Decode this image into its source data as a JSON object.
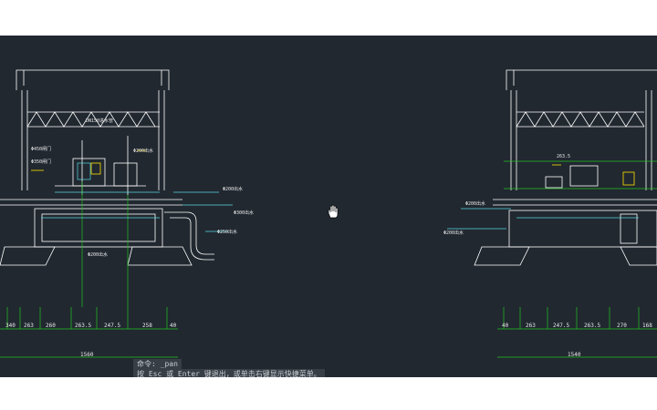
{
  "command_line": {
    "line1": "命令: _pan",
    "line2": "按 Esc 或 Enter 键退出，或单击右键显示快捷菜单。"
  },
  "left_drawing": {
    "labels": [
      {
        "id": "l1",
        "text": "DN150进水管"
      },
      {
        "id": "l2",
        "text": "Φ450闸门"
      },
      {
        "id": "l3",
        "text": "Φ350闸门"
      },
      {
        "id": "l4",
        "text": "Φ200出水"
      },
      {
        "id": "l5",
        "text": "Φ200出水"
      },
      {
        "id": "l6",
        "text": "Φ300出水"
      },
      {
        "id": "l7",
        "text": "Φ250出水"
      },
      {
        "id": "l8",
        "text": "Φ200出水"
      }
    ],
    "dimensions": [
      "340",
      "263",
      "260",
      "263.5",
      "247.5",
      "258",
      "40"
    ],
    "total": "1560"
  },
  "right_drawing": {
    "labels": [
      {
        "id": "r1",
        "text": "263.5"
      },
      {
        "id": "r2",
        "text": "Φ200出水"
      },
      {
        "id": "r3",
        "text": "Φ200出水"
      }
    ],
    "dimensions": [
      "40",
      "263",
      "247.5",
      "263.5",
      "270",
      "168"
    ],
    "total": "1540"
  },
  "colors": {
    "background": "#212830",
    "line_white": "#ffffff",
    "line_green": "#22c422",
    "line_cyan": "#5ad6e0",
    "line_yellow": "#ffe100"
  },
  "cursor_icon": "hand-pan-icon"
}
